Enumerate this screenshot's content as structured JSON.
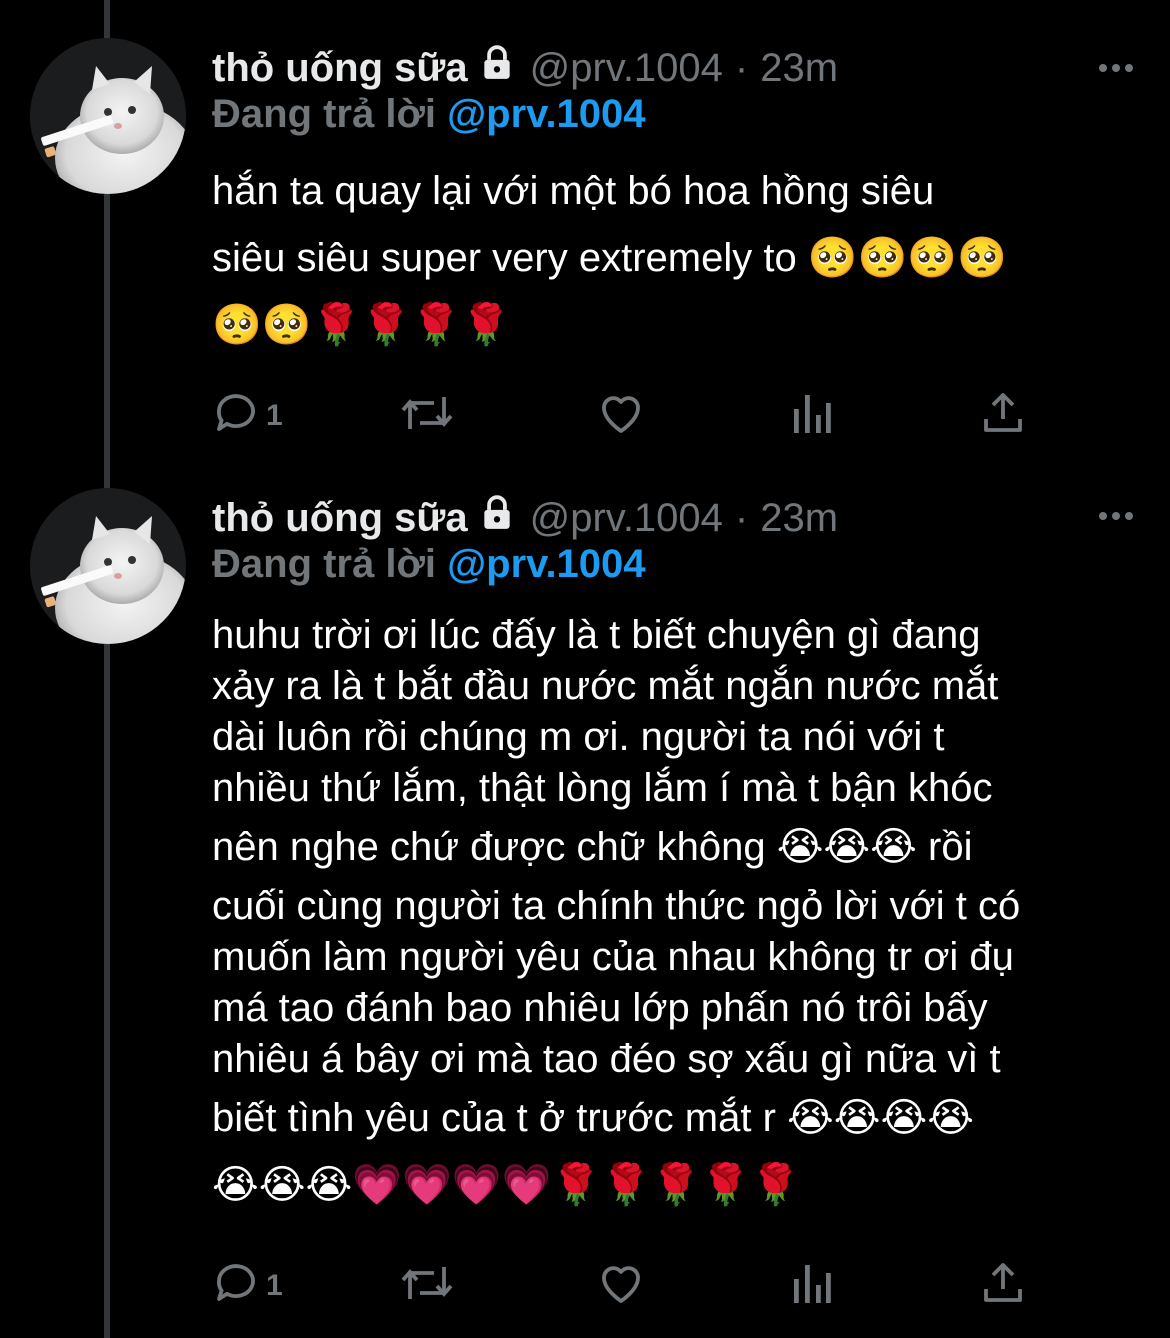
{
  "tweets": [
    {
      "name": "thỏ uống sữa",
      "handle": "@prv.1004",
      "separator": "·",
      "time": "23m",
      "replying_label": "Đang trả lời",
      "replying_to": "@prv.1004",
      "lines": [
        "hắn ta quay lại với một bó hoa hồng siêu",
        "siêu siêu super very extremely to 🥺🥺🥺🥺",
        "🥺🥺🌹🌹🌹🌹"
      ],
      "reply_count": "1",
      "icons": [
        "reply-icon",
        "retweet-icon",
        "like-icon",
        "analytics-icon",
        "share-icon"
      ]
    },
    {
      "name": "thỏ uống sữa",
      "handle": "@prv.1004",
      "separator": "·",
      "time": "23m",
      "replying_label": "Đang trả lời",
      "replying_to": "@prv.1004",
      "lines": [
        "huhu trời ơi lúc đấy là t biết chuyện gì đang",
        "xảy ra là t bắt đầu nước mắt ngắn nước mắt",
        "dài luôn rồi chúng m ơi. người ta nói với t",
        "nhiều thứ lắm, thật lòng lắm í mà t bận khóc",
        "nên nghe chứ được chữ không 😭😭😭 rồi",
        "cuối cùng người ta chính thức ngỏ lời với t có",
        "muốn làm người yêu của nhau không tr ơi đụ",
        "má tao đánh bao nhiêu lớp phấn nó trôi bấy",
        "nhiêu á bây ơi mà tao đéo sợ xấu gì nữa vì t",
        "biết tình yêu của t ở trước mắt r 😭😭😭😭",
        "😭😭😭💗💗💗💗🌹🌹🌹🌹🌹"
      ],
      "reply_count": "1",
      "icons": [
        "reply-icon",
        "retweet-icon",
        "like-icon",
        "analytics-icon",
        "share-icon"
      ]
    }
  ],
  "colors": {
    "background": "#000000",
    "text": "#e7e9ea",
    "muted": "#71767b",
    "accent": "#1d9bf0",
    "thread_line": "#333639"
  }
}
